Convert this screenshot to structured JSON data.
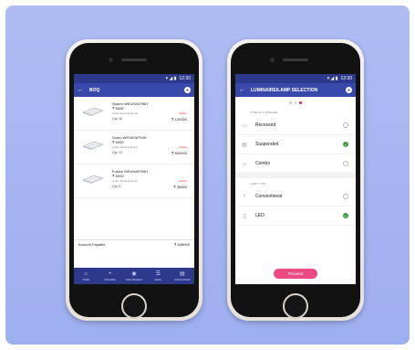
{
  "left_phone": {
    "status": {
      "time": "12:30",
      "signal_icon": "signal-icon",
      "battery_icon": "battery-icon"
    },
    "header": {
      "title": "BOQ"
    },
    "items": [
      {
        "name": "Sparro WEUK06796H",
        "price": "₹ 6000",
        "room": "Cabin Meeting Room",
        "delete": "Delete",
        "qty": "Qty: 10",
        "total": "₹  120000"
      },
      {
        "name": "Sumo WEUK06794H",
        "price": "₹ 6000",
        "room": "Cabin Meeting Room",
        "delete": "Delete",
        "qty": "Qty: 10",
        "total": "₹  600000"
      },
      {
        "name": "Fusion WEUK06799H",
        "price": "₹ 6000",
        "room": "Cabin Meeting Room",
        "delete": "Delete",
        "qty": "Qty: 8",
        "total": "₹    36000"
      }
    ],
    "payable": {
      "label": "Amount Payable",
      "value": "₹  648000"
    },
    "nav": [
      {
        "icon": "⌂",
        "label": "HOME"
      },
      {
        "icon": "+",
        "label": "ADD AREA"
      },
      {
        "icon": "◉",
        "label": "VIEW PROJECT"
      },
      {
        "icon": "☰",
        "label": "EMAIL"
      },
      {
        "icon": "▤",
        "label": "SAVE/UPDATE"
      }
    ]
  },
  "right_phone": {
    "status": {
      "time": "12:30"
    },
    "header": {
      "title": "LUMINAIRE/LAMP SELECTION"
    },
    "type_label": "TYPE OF LUMINAIRE",
    "types": [
      {
        "icon": "▭",
        "label": "Recessed",
        "checked": false
      },
      {
        "icon": "▤",
        "label": "Suspended",
        "checked": true
      },
      {
        "icon": "▱",
        "label": "Combo",
        "checked": false
      }
    ],
    "lamp_label": "LAMP TYPE",
    "lamps": [
      {
        "icon": "♀",
        "label": "Conventional",
        "checked": false
      },
      {
        "icon": "▯",
        "label": "LED",
        "checked": true
      }
    ],
    "proceed_label": "Proceed",
    "check_glyph": "✓"
  },
  "colors": {
    "primary": "#3949ab",
    "accent": "#ec4a82",
    "success": "#43a047"
  }
}
